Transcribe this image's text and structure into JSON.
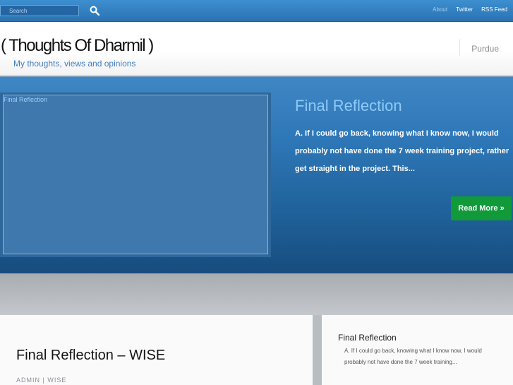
{
  "topbar": {
    "search_placeholder": "Search",
    "links": [
      "About",
      "Twitter",
      "RSS Feed"
    ]
  },
  "header": {
    "site_title": "( Thoughts Of Dharmil )",
    "tagline": "My thoughts, views and opinions",
    "nav_item": "Purdue"
  },
  "featured": {
    "image_alt": "Final Reflection",
    "title": "Final Reflection",
    "excerpt": "A. If I could go back, knowing what I know now, I would probably not have done the 7 week training project, rather get straight in the project. This...",
    "read_more": "Read More »"
  },
  "post": {
    "title": "Final Reflection – WISE",
    "meta": "ADMIN | WISE"
  },
  "sidebar": {
    "title": "Final Reflection",
    "excerpt": "A. If I could go back, knowing what I know now, I would probably not have done the 7 week training..."
  }
}
